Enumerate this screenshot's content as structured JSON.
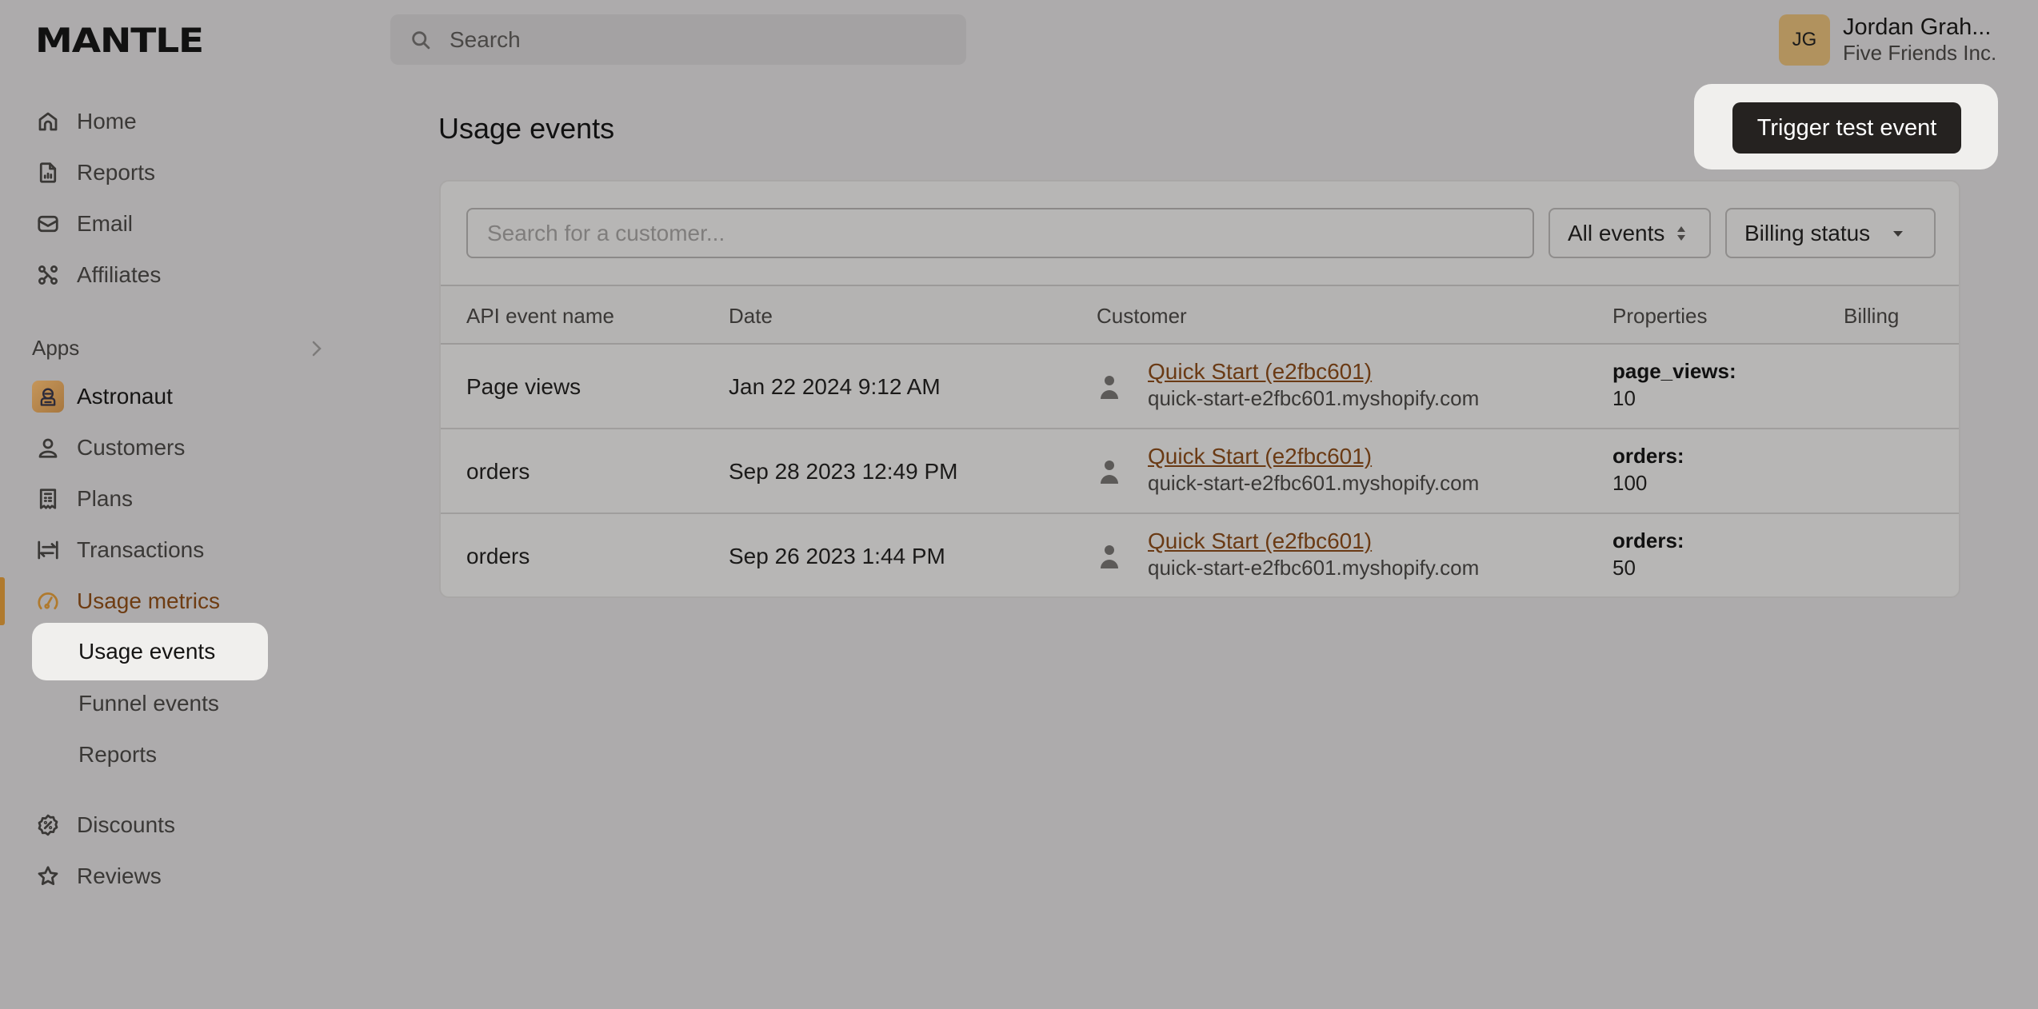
{
  "brand": {
    "logo_text": "MANTLE",
    "accent": "#b07a2e",
    "active_text": "#6e3c12",
    "link": "#6a3a14"
  },
  "topbar": {
    "search_placeholder": "Search",
    "user": {
      "initials": "JG",
      "name": "Jordan Grah...",
      "org": "Five Friends Inc."
    }
  },
  "sidebar": {
    "main_items": [
      {
        "label": "Home",
        "icon": "home-icon"
      },
      {
        "label": "Reports",
        "icon": "report-icon"
      },
      {
        "label": "Email",
        "icon": "mail-icon"
      },
      {
        "label": "Affiliates",
        "icon": "affiliates-icon"
      }
    ],
    "apps_label": "Apps",
    "app_name": "Astronaut",
    "app_items": [
      {
        "label": "Customers",
        "icon": "user-icon"
      },
      {
        "label": "Plans",
        "icon": "receipt-icon"
      },
      {
        "label": "Transactions",
        "icon": "transfer-icon"
      },
      {
        "label": "Usage metrics",
        "icon": "gauge-icon",
        "active": true
      }
    ],
    "sub_items": [
      {
        "label": "Usage events",
        "selected": true
      },
      {
        "label": "Funnel events"
      },
      {
        "label": "Reports"
      }
    ],
    "bottom_items": [
      {
        "label": "Discounts",
        "icon": "discount-icon"
      },
      {
        "label": "Reviews",
        "icon": "star-icon"
      }
    ]
  },
  "page": {
    "title": "Usage events",
    "trigger_button": "Trigger test event"
  },
  "filters": {
    "customer_search_placeholder": "Search for a customer...",
    "event_select": "All events",
    "billing_select": "Billing status"
  },
  "table": {
    "columns": [
      "API event name",
      "Date",
      "Customer",
      "Properties",
      "Billing"
    ],
    "rows": [
      {
        "event": "Page views",
        "date": "Jan 22 2024 9:12 AM",
        "customer_name": "Quick Start (e2fbc601)",
        "customer_domain": "quick-start-e2fbc601.myshopify.com",
        "prop_key": "page_views:",
        "prop_value": "10",
        "billing": ""
      },
      {
        "event": "orders",
        "date": "Sep 28 2023 12:49 PM",
        "customer_name": "Quick Start (e2fbc601)",
        "customer_domain": "quick-start-e2fbc601.myshopify.com",
        "prop_key": "orders:",
        "prop_value": "100",
        "billing": ""
      },
      {
        "event": "orders",
        "date": "Sep 26 2023 1:44 PM",
        "customer_name": "Quick Start (e2fbc601)",
        "customer_domain": "quick-start-e2fbc601.myshopify.com",
        "prop_key": "orders:",
        "prop_value": "50",
        "billing": ""
      }
    ]
  }
}
